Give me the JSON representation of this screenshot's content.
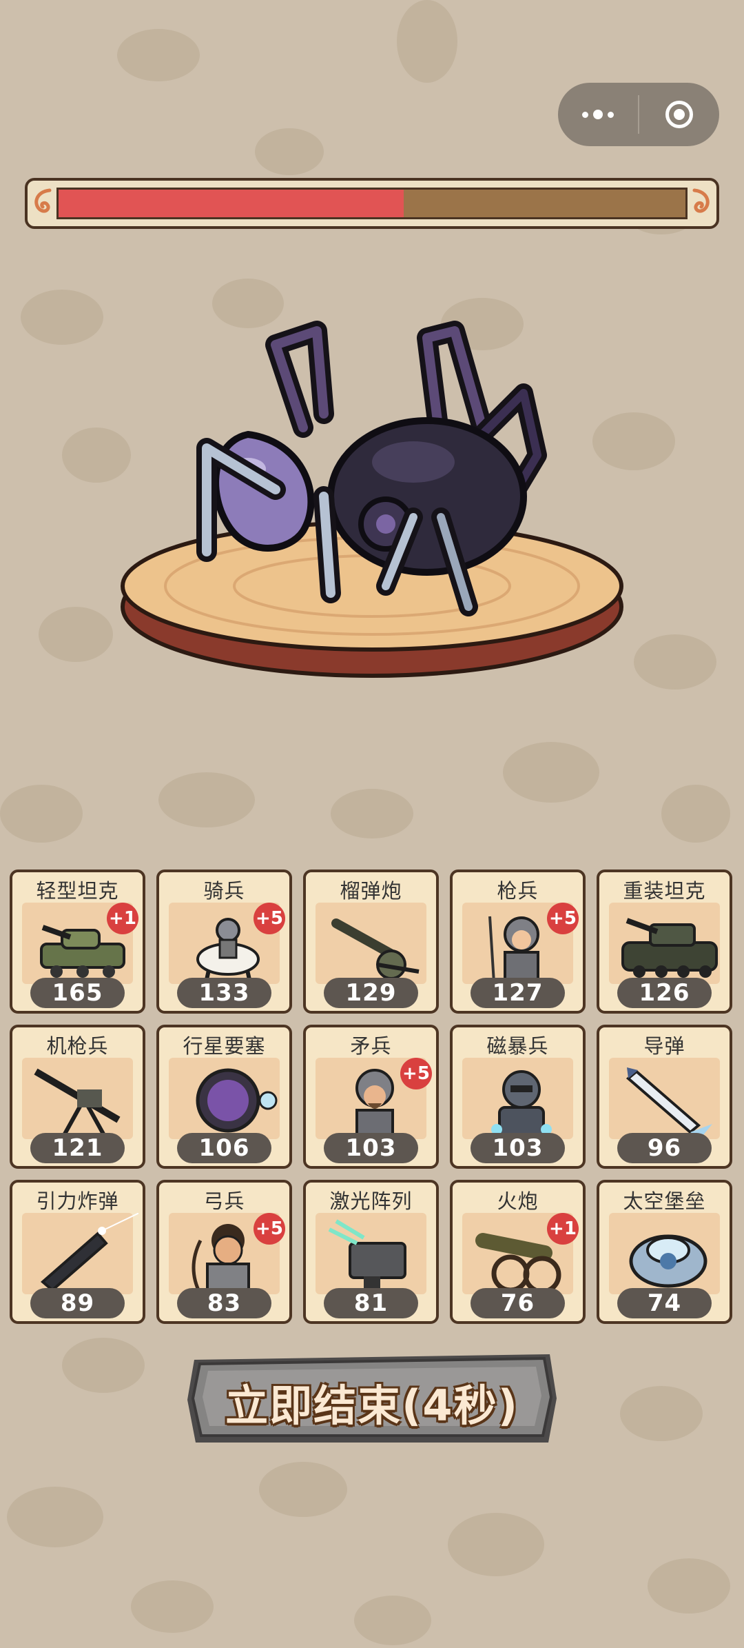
{
  "capsule": {
    "menu_icon": "more-dots-icon",
    "close_icon": "target-close-icon"
  },
  "boss": {
    "health_fraction": 0.55,
    "icon": "spider-boss"
  },
  "units": [
    {
      "name": "轻型坦克",
      "count": "165",
      "bonus": "+1",
      "icon": "light-tank"
    },
    {
      "name": "骑兵",
      "count": "133",
      "bonus": "+5",
      "icon": "cavalry"
    },
    {
      "name": "榴弹炮",
      "count": "129",
      "bonus": "",
      "icon": "howitzer"
    },
    {
      "name": "枪兵",
      "count": "127",
      "bonus": "+5",
      "icon": "spearman"
    },
    {
      "name": "重装坦克",
      "count": "126",
      "bonus": "",
      "icon": "heavy-tank"
    },
    {
      "name": "机枪兵",
      "count": "121",
      "bonus": "",
      "icon": "machine-gunner"
    },
    {
      "name": "行星要塞",
      "count": "106",
      "bonus": "",
      "icon": "planet-fortress"
    },
    {
      "name": "矛兵",
      "count": "103",
      "bonus": "+5",
      "icon": "pikeman"
    },
    {
      "name": "磁暴兵",
      "count": "103",
      "bonus": "",
      "icon": "tesla-trooper"
    },
    {
      "name": "导弹",
      "count": "96",
      "bonus": "",
      "icon": "missile"
    },
    {
      "name": "引力炸弹",
      "count": "89",
      "bonus": "",
      "icon": "gravity-bomb"
    },
    {
      "name": "弓兵",
      "count": "83",
      "bonus": "+5",
      "icon": "archer"
    },
    {
      "name": "激光阵列",
      "count": "81",
      "bonus": "",
      "icon": "laser-array"
    },
    {
      "name": "火炮",
      "count": "76",
      "bonus": "+1",
      "icon": "cannon"
    },
    {
      "name": "太空堡垒",
      "count": "74",
      "bonus": "",
      "icon": "space-fortress"
    }
  ],
  "end_button": {
    "label": "立即结束(4秒)"
  },
  "colors": {
    "background": "#cdbfac",
    "health": "#e15454",
    "health_empty": "#9b7449",
    "card": "#f6e6c6"
  }
}
